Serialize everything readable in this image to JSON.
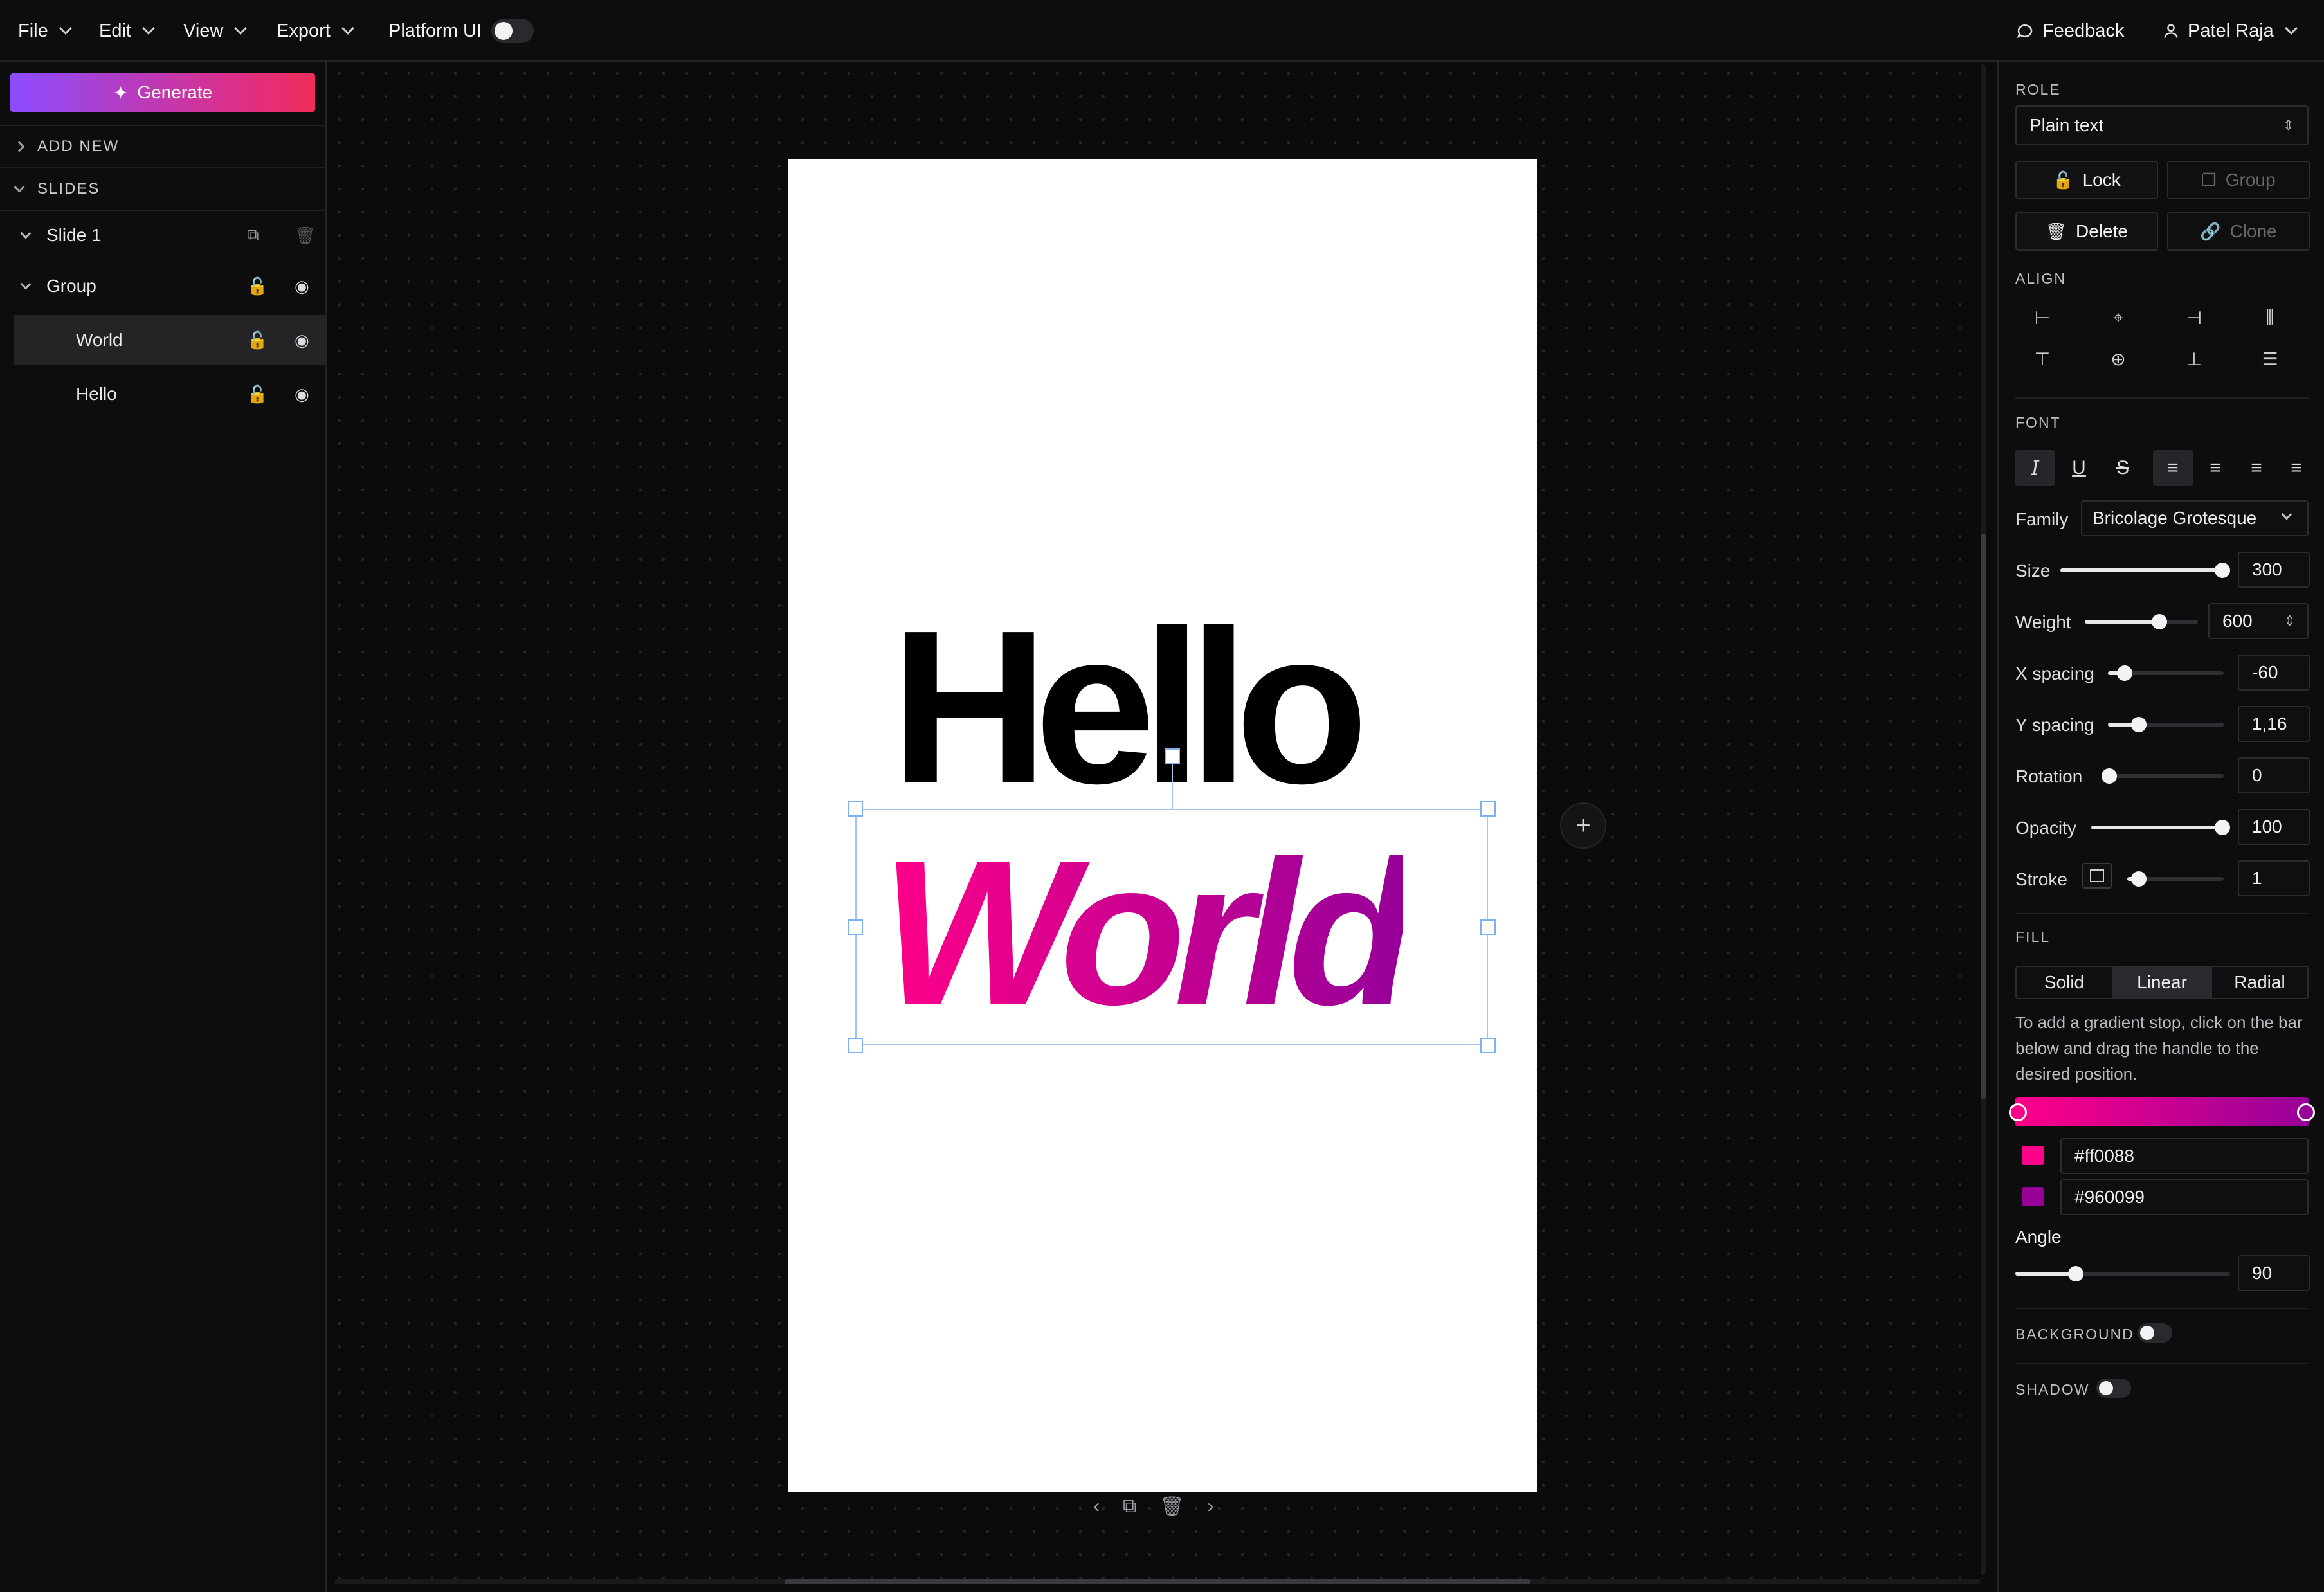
{
  "menubar": {
    "file": "File",
    "edit": "Edit",
    "view": "View",
    "export": "Export",
    "platform_ui": "Platform UI",
    "feedback": "Feedback",
    "user": "Patel Raja"
  },
  "left_panel": {
    "generate": "Generate",
    "add_new": "ADD NEW",
    "slides": "SLIDES",
    "layers": [
      {
        "label": "Slide 1",
        "kind": "slide"
      },
      {
        "label": "Group",
        "kind": "group"
      },
      {
        "label": "World",
        "kind": "text",
        "selected": true
      },
      {
        "label": "Hello",
        "kind": "text"
      }
    ]
  },
  "canvas": {
    "text_hello": "Hello",
    "text_world": "World"
  },
  "right_panel": {
    "role_label": "ROLE",
    "role_value": "Plain text",
    "lock": "Lock",
    "group": "Group",
    "delete": "Delete",
    "clone": "Clone",
    "align_label": "ALIGN",
    "font_label": "FONT",
    "family_label": "Family",
    "family_value": "Bricolage Grotesque",
    "size_label": "Size",
    "size_value": "300",
    "weight_label": "Weight",
    "weight_value": "600",
    "xspacing_label": "X spacing",
    "xspacing_value": "-60",
    "yspacing_label": "Y spacing",
    "yspacing_value": "1,16",
    "rotation_label": "Rotation",
    "rotation_value": "0",
    "opacity_label": "Opacity",
    "opacity_value": "100",
    "stroke_label": "Stroke",
    "stroke_value": "1",
    "fill_label": "FILL",
    "fill_solid": "Solid",
    "fill_linear": "Linear",
    "fill_radial": "Radial",
    "fill_hint": "To add a gradient stop, click on the bar below and drag the handle to the desired position.",
    "stop1": "#ff0088",
    "stop2": "#960099",
    "angle_label": "Angle",
    "angle_value": "90",
    "background_label": "BACKGROUND",
    "shadow_label": "SHADOW"
  },
  "colors": {
    "gradient_start": "#ff0088",
    "gradient_end": "#960099",
    "generate_start": "#8b4cff",
    "generate_end": "#f12c5a"
  }
}
